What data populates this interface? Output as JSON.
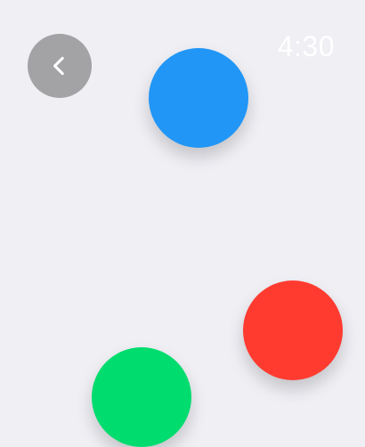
{
  "header": {
    "back_icon": "chevron-left-icon",
    "timer_text": "4:30"
  },
  "dots": [
    {
      "name": "dot-blue",
      "color": "#2196f6"
    },
    {
      "name": "dot-red",
      "color": "#ff3b30"
    },
    {
      "name": "dot-green",
      "color": "#00dc6e"
    }
  ],
  "colors": {
    "background": "#efeff4",
    "back_button": "#a3a3a5",
    "timer_text": "#ffffff"
  }
}
